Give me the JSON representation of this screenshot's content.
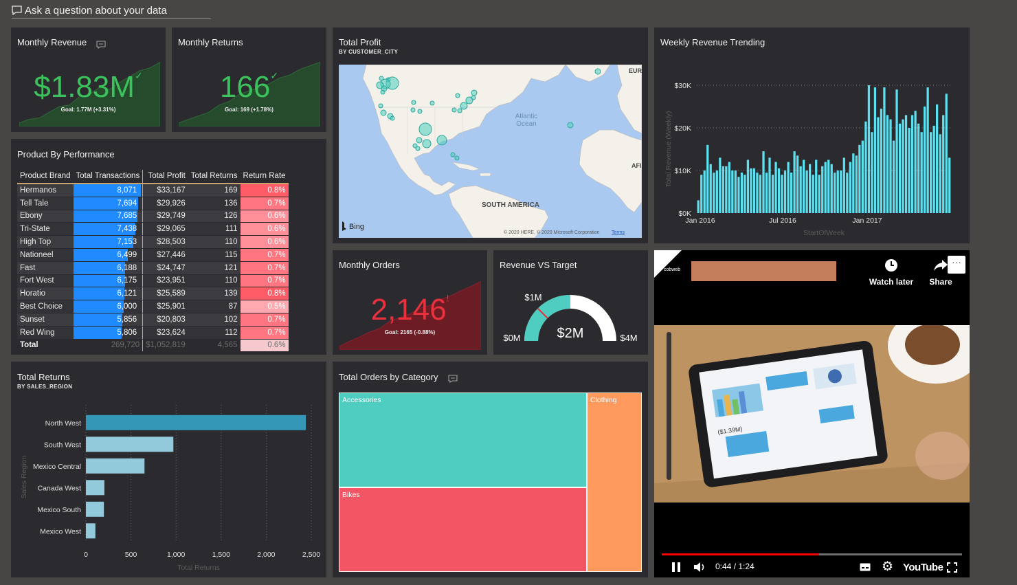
{
  "qa": {
    "label": "Ask a question about your data"
  },
  "revenue": {
    "title": "Monthly Revenue",
    "value": "$1.83M",
    "goal": "Goal: 1.77M (+3.31%)"
  },
  "returns": {
    "title": "Monthly Returns",
    "value": "166",
    "goal": "Goal: 169 (+1.78%)"
  },
  "profit_map": {
    "title": "Total Profit",
    "subtitle": "BY CUSTOMER_CITY",
    "labels": {
      "ocean": "Atlantic\nOcean",
      "sa": "SOUTH AMERICA",
      "eur": "EUR",
      "afr": "AFI"
    },
    "bing": "Bing",
    "attribution": "© 2020 HERE, © 2020 Microsoft Corporation",
    "terms": "Terms"
  },
  "weekly": {
    "title": "Weekly Revenue Trending"
  },
  "product": {
    "title": "Product By Performance",
    "columns": [
      "Product Brand",
      "Total Transactions",
      "Total Profit",
      "Total Returns",
      "Return Rate"
    ],
    "rows": [
      {
        "brand": "Hermanos",
        "tx": "8,071",
        "txv": 8071,
        "profit": "$33,167",
        "ret": "169",
        "rate": "0.8%",
        "rv": 0.8
      },
      {
        "brand": "Tell Tale",
        "tx": "7,694",
        "txv": 7694,
        "profit": "$29,926",
        "ret": "136",
        "rate": "0.7%",
        "rv": 0.7
      },
      {
        "brand": "Ebony",
        "tx": "7,685",
        "txv": 7685,
        "profit": "$29,749",
        "ret": "126",
        "rate": "0.6%",
        "rv": 0.6
      },
      {
        "brand": "Tri-State",
        "tx": "7,438",
        "txv": 7438,
        "profit": "$29,065",
        "ret": "111",
        "rate": "0.6%",
        "rv": 0.6
      },
      {
        "brand": "High Top",
        "tx": "7,153",
        "txv": 7153,
        "profit": "$28,503",
        "ret": "110",
        "rate": "0.6%",
        "rv": 0.6
      },
      {
        "brand": "Nationeel",
        "tx": "6,499",
        "txv": 6499,
        "profit": "$27,446",
        "ret": "115",
        "rate": "0.7%",
        "rv": 0.7
      },
      {
        "brand": "Fast",
        "tx": "6,188",
        "txv": 6188,
        "profit": "$24,747",
        "ret": "121",
        "rate": "0.7%",
        "rv": 0.7
      },
      {
        "brand": "Fort West",
        "tx": "6,175",
        "txv": 6175,
        "profit": "$23,951",
        "ret": "110",
        "rate": "0.7%",
        "rv": 0.7
      },
      {
        "brand": "Horatio",
        "tx": "6,121",
        "txv": 6121,
        "profit": "$25,589",
        "ret": "139",
        "rate": "0.8%",
        "rv": 0.8
      },
      {
        "brand": "Best Choice",
        "tx": "6,000",
        "txv": 6000,
        "profit": "$25,901",
        "ret": "87",
        "rate": "0.5%",
        "rv": 0.5
      },
      {
        "brand": "Sunset",
        "tx": "5,856",
        "txv": 5856,
        "profit": "$20,803",
        "ret": "102",
        "rate": "0.7%",
        "rv": 0.7
      },
      {
        "brand": "Red Wing",
        "tx": "5,806",
        "txv": 5806,
        "profit": "$23,624",
        "ret": "112",
        "rate": "0.7%",
        "rv": 0.7
      }
    ],
    "total": {
      "label": "Total",
      "tx": "269,720",
      "profit": "$1,052,819",
      "ret": "4,565",
      "rate": "0.6%"
    }
  },
  "orders": {
    "title": "Monthly Orders",
    "value": "2,146",
    "goal": "Goal: 2165 (-0.88%)"
  },
  "gauge": {
    "title": "Revenue VS Target",
    "value": "$2M",
    "min": "$0M",
    "max": "$4M",
    "target": "$1M",
    "fraction": 0.5,
    "target_fraction": 0.25
  },
  "returns_region": {
    "title": "Total Returns",
    "subtitle": "BY SALES_REGION",
    "xlabel": "Total Returns",
    "ylabel": "Sales Region"
  },
  "category": {
    "title": "Total Orders by Category",
    "cells": [
      {
        "label": "Accessories",
        "color": "#4ecdc0"
      },
      {
        "label": "Bikes",
        "color": "#f25664"
      },
      {
        "label": "Clothing",
        "color": "#ff9a5c"
      }
    ]
  },
  "video": {
    "logo": "cobweb",
    "watch_later": "Watch later",
    "share": "Share",
    "time": "0:44 / 1:24",
    "progress": 0.524,
    "youtube": "YouTube",
    "screen_value": "($1.39M)"
  },
  "chart_data": [
    {
      "type": "bar",
      "title": "Weekly Revenue Trending",
      "xlabel": "StartOfWeek",
      "ylabel": "Total Revenue (Weekly)",
      "ylim": [
        0,
        30000
      ],
      "yticks": [
        "$0K",
        "$10K",
        "$20K",
        "$30K"
      ],
      "xticks": [
        "Jan 2016",
        "Jul 2016",
        "Jan 2017"
      ],
      "color": "#5ce1f0",
      "values": [
        3000,
        9000,
        10000,
        16000,
        11500,
        9500,
        10000,
        13000,
        11000,
        11000,
        12000,
        10000,
        10000,
        8500,
        9500,
        9000,
        12500,
        10500,
        10500,
        9500,
        9000,
        14500,
        9500,
        13000,
        9000,
        12000,
        10500,
        9000,
        10000,
        12000,
        9500,
        14500,
        13500,
        11000,
        12500,
        10000,
        11500,
        9000,
        12500,
        9000,
        11000,
        12000,
        12500,
        11500,
        9500,
        10000,
        10000,
        13000,
        9500,
        12000,
        14000,
        13500,
        16000,
        17000,
        21500,
        30000,
        19000,
        29500,
        22500,
        24500,
        29500,
        23000,
        22000,
        17000,
        29000,
        21000,
        22000,
        23000,
        20000,
        23000,
        24000,
        21000,
        19000,
        25000,
        29500,
        19000,
        20500,
        25500,
        18500,
        23000,
        28000,
        13000
      ]
    },
    {
      "type": "bar",
      "title": "Total Returns",
      "subtitle": "BY SALES_REGION",
      "orientation": "horizontal",
      "categories": [
        "North West",
        "South West",
        "Mexico Central",
        "Canada West",
        "Mexico South",
        "Mexico West"
      ],
      "values": [
        2440,
        970,
        650,
        205,
        200,
        105
      ],
      "xlim": [
        0,
        2500
      ],
      "xticks": [
        "0",
        "500",
        "1,000",
        "1,500",
        "2,000",
        "2,500"
      ],
      "xlabel": "Total Returns",
      "ylabel": "Sales Region"
    },
    {
      "type": "line",
      "title": "Monthly Revenue sparkline",
      "values": [
        0.05,
        0.1,
        0.12,
        0.2,
        0.28,
        0.3,
        0.42,
        0.45,
        0.55,
        0.52,
        0.62,
        0.7,
        0.78,
        0.82,
        0.9
      ]
    },
    {
      "type": "line",
      "title": "Monthly Returns sparkline",
      "values": [
        0.05,
        0.1,
        0.15,
        0.2,
        0.3,
        0.35,
        0.45,
        0.5,
        0.55,
        0.6,
        0.68,
        0.72,
        0.8,
        0.85,
        0.9
      ]
    },
    {
      "type": "line",
      "title": "Monthly Orders sparkline",
      "values": [
        0.05,
        0.12,
        0.18,
        0.25,
        0.3,
        0.4,
        0.45,
        0.5,
        0.58,
        0.62,
        0.7,
        0.75,
        0.82,
        0.88,
        0.95
      ]
    }
  ]
}
